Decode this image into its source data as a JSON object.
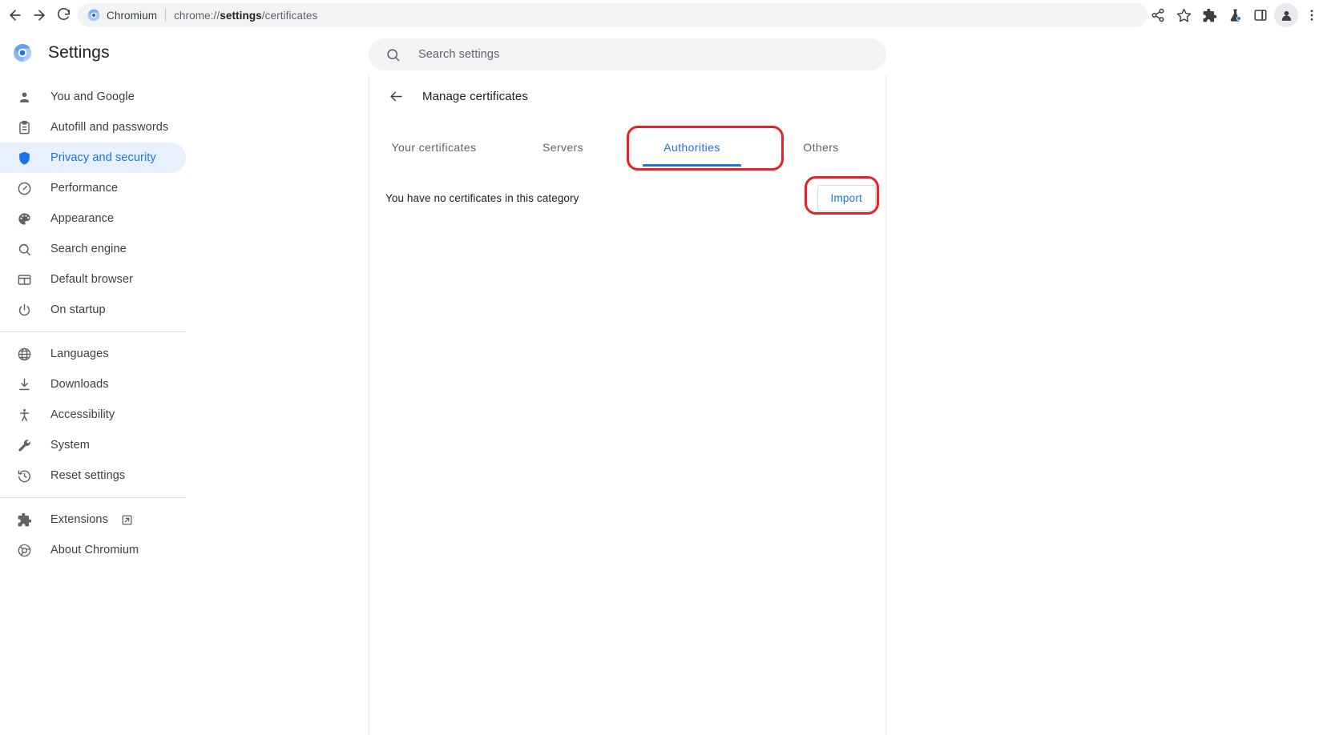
{
  "browser": {
    "nav": {
      "back_label": "Back",
      "forward_label": "Forward",
      "reload_label": "Reload"
    },
    "omnibox": {
      "app_chip": "Chromium",
      "url_scheme": "chrome://",
      "url_bold": "settings",
      "url_rest": "/certificates",
      "full_url": "chrome://settings/certificates"
    },
    "toolbar_icons": [
      {
        "name": "share-icon",
        "label": "Share"
      },
      {
        "name": "bookmark-star-icon",
        "label": "Bookmark this tab"
      },
      {
        "name": "extensions-puzzle-icon",
        "label": "Extensions"
      },
      {
        "name": "flask-experiment-icon",
        "label": "Experiments"
      },
      {
        "name": "side-panel-icon",
        "label": "Side panel"
      },
      {
        "name": "profile-avatar-icon",
        "label": "Profile"
      },
      {
        "name": "three-dot-menu-icon",
        "label": "Customize and control Chromium"
      }
    ]
  },
  "header": {
    "title": "Settings",
    "logo_name": "chromium-logo"
  },
  "search": {
    "placeholder": "Search settings",
    "value": "",
    "icon": "search-icon"
  },
  "sidebar": {
    "groups": [
      {
        "items": [
          {
            "label": "You and Google",
            "icon": "person-icon",
            "selected": false
          },
          {
            "label": "Autofill and passwords",
            "icon": "clipboard-icon",
            "selected": false
          },
          {
            "label": "Privacy and security",
            "icon": "shield-icon",
            "selected": true
          },
          {
            "label": "Performance",
            "icon": "speedometer-icon",
            "selected": false
          },
          {
            "label": "Appearance",
            "icon": "palette-icon",
            "selected": false
          },
          {
            "label": "Search engine",
            "icon": "magnifier-icon",
            "selected": false
          },
          {
            "label": "Default browser",
            "icon": "browser-window-icon",
            "selected": false
          },
          {
            "label": "On startup",
            "icon": "power-icon",
            "selected": false
          }
        ]
      },
      {
        "items": [
          {
            "label": "Languages",
            "icon": "globe-icon",
            "selected": false
          },
          {
            "label": "Downloads",
            "icon": "download-icon",
            "selected": false
          },
          {
            "label": "Accessibility",
            "icon": "accessibility-icon",
            "selected": false
          },
          {
            "label": "System",
            "icon": "wrench-icon",
            "selected": false
          },
          {
            "label": "Reset settings",
            "icon": "history-undo-icon",
            "selected": false
          }
        ]
      },
      {
        "items": [
          {
            "label": "Extensions",
            "icon": "puzzle-icon",
            "selected": false,
            "external": true
          },
          {
            "label": "About Chromium",
            "icon": "chromium-outline-icon",
            "selected": false
          }
        ]
      }
    ]
  },
  "main": {
    "back_icon": "arrow-back-icon",
    "page_title": "Manage certificates",
    "tabs": [
      {
        "label": "Your certificates",
        "active": false
      },
      {
        "label": "Servers",
        "active": false
      },
      {
        "label": "Authorities",
        "active": true
      },
      {
        "label": "Others",
        "active": false
      }
    ],
    "empty_state_text": "You have no certificates in this category",
    "import_button_label": "Import"
  },
  "annotations": [
    {
      "name": "authorities-tab-highlight",
      "target": "Authorities tab"
    },
    {
      "name": "import-button-highlight",
      "target": "Import button"
    }
  ],
  "colors": {
    "accent_blue": "#1a73e8",
    "selected_pill": "#e8f0fe",
    "annotation_red": "#e8202a",
    "text_primary": "#202124",
    "text_secondary": "#5f6368",
    "omnibox_bg": "#f1f3f4",
    "divider": "#dadce0"
  }
}
